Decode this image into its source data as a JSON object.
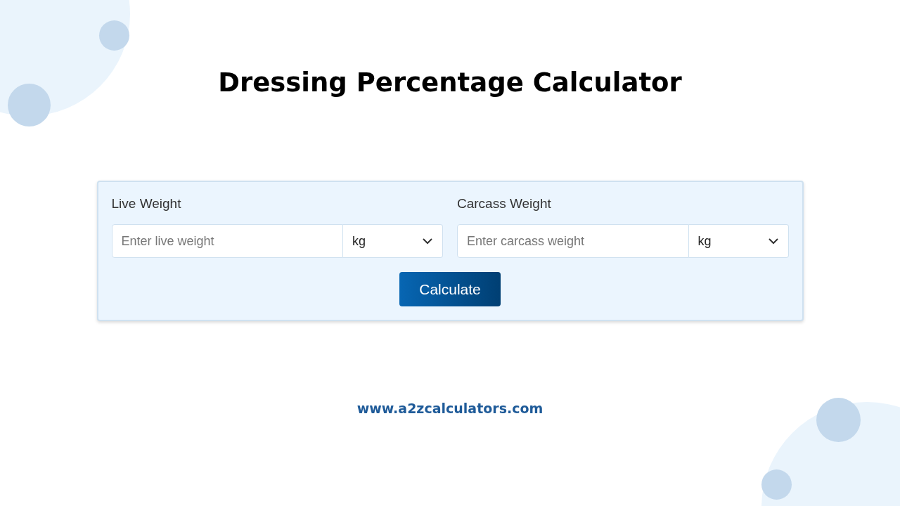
{
  "title": "Dressing Percentage Calculator",
  "fields": [
    {
      "label": "Live Weight",
      "placeholder": "Enter live weight",
      "unit": "kg"
    },
    {
      "label": "Carcass Weight",
      "placeholder": "Enter carcass weight",
      "unit": "kg"
    }
  ],
  "button": "Calculate",
  "footer": "www.a2zcalculators.com"
}
